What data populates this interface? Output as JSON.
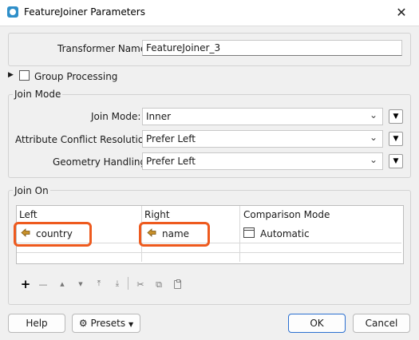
{
  "window": {
    "title": "FeatureJoiner Parameters",
    "close_glyph": "✕"
  },
  "transformer": {
    "label": "Transformer Name:",
    "value": "FeatureJoiner_3"
  },
  "group_processing": {
    "expander": "▶",
    "label": "Group Processing",
    "checked": false
  },
  "join_mode_group": {
    "title": "Join Mode",
    "join_mode": {
      "label": "Join Mode:",
      "value": "Inner"
    },
    "conflict": {
      "label": "Attribute Conflict Resolution:",
      "value": "Prefer Left"
    },
    "geometry": {
      "label": "Geometry Handling:",
      "value": "Prefer Left"
    }
  },
  "join_on_group": {
    "title": "Join On",
    "columns": [
      "Left",
      "Right",
      "Comparison Mode"
    ],
    "rows": [
      {
        "left": "country",
        "right": "name",
        "mode": "Automatic"
      }
    ]
  },
  "toolbar": {
    "add": "+",
    "remove": "—",
    "up": "▲",
    "down": "▼",
    "top": "⤒",
    "bottom": "⤓",
    "cut": "✂",
    "copy": "⧉",
    "paste": "📋"
  },
  "buttons": {
    "help": "Help",
    "presets": "Presets",
    "ok": "OK",
    "cancel": "Cancel"
  },
  "colors": {
    "highlight": "#ee5a1e",
    "attr_icon": "#c8902a",
    "accent": "#2a6fd0"
  }
}
